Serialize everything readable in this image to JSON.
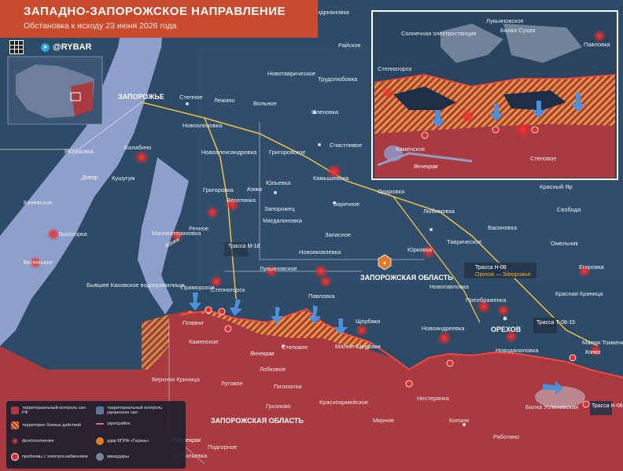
{
  "header": {
    "title": "ЗАПАДНО-ЗАПОРОЖСКОЕ НАПРАВЛЕНИЕ",
    "subtitle": "Обстановка к исходу 23 июня 2026 года"
  },
  "brand": {
    "name": "@RYBAR"
  },
  "colors": {
    "russian_control": "#a83a40",
    "ukrainian_control": "#2d4a66",
    "water": "#8f9fcc",
    "contested": "#e3973a",
    "road": "#f1c04a"
  },
  "regions": {
    "zaporozhye_oblast": "ЗАПОРОЖСКАЯ ОБЛАСТЬ",
    "zaporozhye_oblast_lower": "ЗАПОРОЖСКАЯ ОБЛАСТЬ"
  },
  "water_labels": {
    "dnepr": "Днепр",
    "konka_1": "Конка",
    "konka_2": "Конка",
    "konka_3": "Конка",
    "yanchekrak": "Янчекрак",
    "yanchekrak_inset": "Янчекрак",
    "karachekrak": "Карачекрак",
    "reservoir": "Бывшее Каховское водохранилище"
  },
  "highways": {
    "m18": "Трасса М-18",
    "h08": "Трасса Н-08",
    "h08_sub": "Орехов — Запорожье",
    "t0815": "Трасса Т-08-15",
    "h08_bottom": "Трасса Н-08"
  },
  "settlements": {
    "andrianovka": "Андриановка",
    "rayskoe": "Райское",
    "zaporozhye": "ЗАПОРОЖЬЕ",
    "novotavricheskoe": "Новотаврическое",
    "trudolyubovka": "Трудолюбовка",
    "stepnoe_n": "Степное",
    "lezhino": "Лежино",
    "volnoe": "Вольное",
    "olenovka": "Оленовка",
    "novoolenovka": "Новооленовка",
    "schastlivoe": "Счастливое",
    "razumovka": "Разумовка",
    "balabino": "Балабино",
    "novoaleksandrovka": "Новоалександровка",
    "grigorovskoe": "Григоровское",
    "kushugum": "Кушугум",
    "yulevka": "Юльевка",
    "kamyshevakha": "Камышеваха",
    "grigorovka": "Григоровка",
    "odarovka": "Одаровка",
    "kanevskoe": "Каневское",
    "veselyanka": "Веселянка",
    "zaporozhets": "Запорожец",
    "zarechnoe": "Заречное",
    "lyubimovka": "Любимовка",
    "lysogorka": "Лысогорка",
    "malokaterinovka": "Малокатериновка",
    "rechnoe": "Речное",
    "magdalinovka": "Магдалиновка",
    "zapasnoe": "Запасное",
    "tavricheskoe": "Таврическое",
    "vasinovka": "Васиновка",
    "krasny_yar": "Красный Яр",
    "svoboda": "Свобода",
    "omelnik": "Омельник",
    "belenkoe": "Беленькое",
    "yurkovka": "Юрковка",
    "novoyakovlevka": "Новояковлевка",
    "lukyanovskoe": "Лукьяновское",
    "egorovka": "Егоровка",
    "primorskoe": "Приморское",
    "stepnogorsk": "Степногорск",
    "pavlovka": "Павловка",
    "novopavlovka": "Новопавловка",
    "krasnaya_krinitsa": "Красная Криница",
    "preobrazhenka": "Преображенка",
    "plavni": "Плавни",
    "kamenskoe": "Каменское",
    "shcherbaki": "Щербаки",
    "novoandreevka": "Новоандреевка",
    "orekhov": "ОРЕХОВ",
    "malaya_tokmachka": "Малая Токмачка",
    "stepovoe": "Степовое",
    "malye_shcherbaki": "Малые Щербаки",
    "novodanilovka": "Новоданиловка",
    "lobkovoe": "Лобковое",
    "verkhnyaya_krinitsa": "Верхняя Криница",
    "lugovoe": "Луговое",
    "pyatikhatki": "Пятихатки",
    "nesteryanka": "Нестерянка",
    "balka_uspenovskaya": "Балка Успеновская",
    "groznovo": "Грозново",
    "krasnoarmeyskoe": "Красноармейское",
    "mirnoe": "Мирное",
    "kopani": "Копани",
    "rabotino": "Работино",
    "podgornoe": "Подгорное",
    "vasilyevka": "Васильевка"
  },
  "inset": {
    "lukyanovskoe": "Лукьяновское",
    "balka_sukhaya": "Балка Сухая",
    "pavlovka": "Павловка",
    "solar_station": "Солнечная электростанция",
    "stepnogorsk": "Степногорск",
    "kamenskoe": "Каменское",
    "stepovoe": "Степовое"
  },
  "legend": {
    "russian": "территориальный контроль сил РФ",
    "ukrainian": "территориальный контроль украинских сил",
    "contested": "территория боевых действий",
    "fortified": "укрепрайон",
    "strikes": "фонтополнения",
    "uav": "удар БПЛА «Герань»",
    "power": "проблемы с электроснабжением",
    "aviabomb": "авиаудары"
  }
}
